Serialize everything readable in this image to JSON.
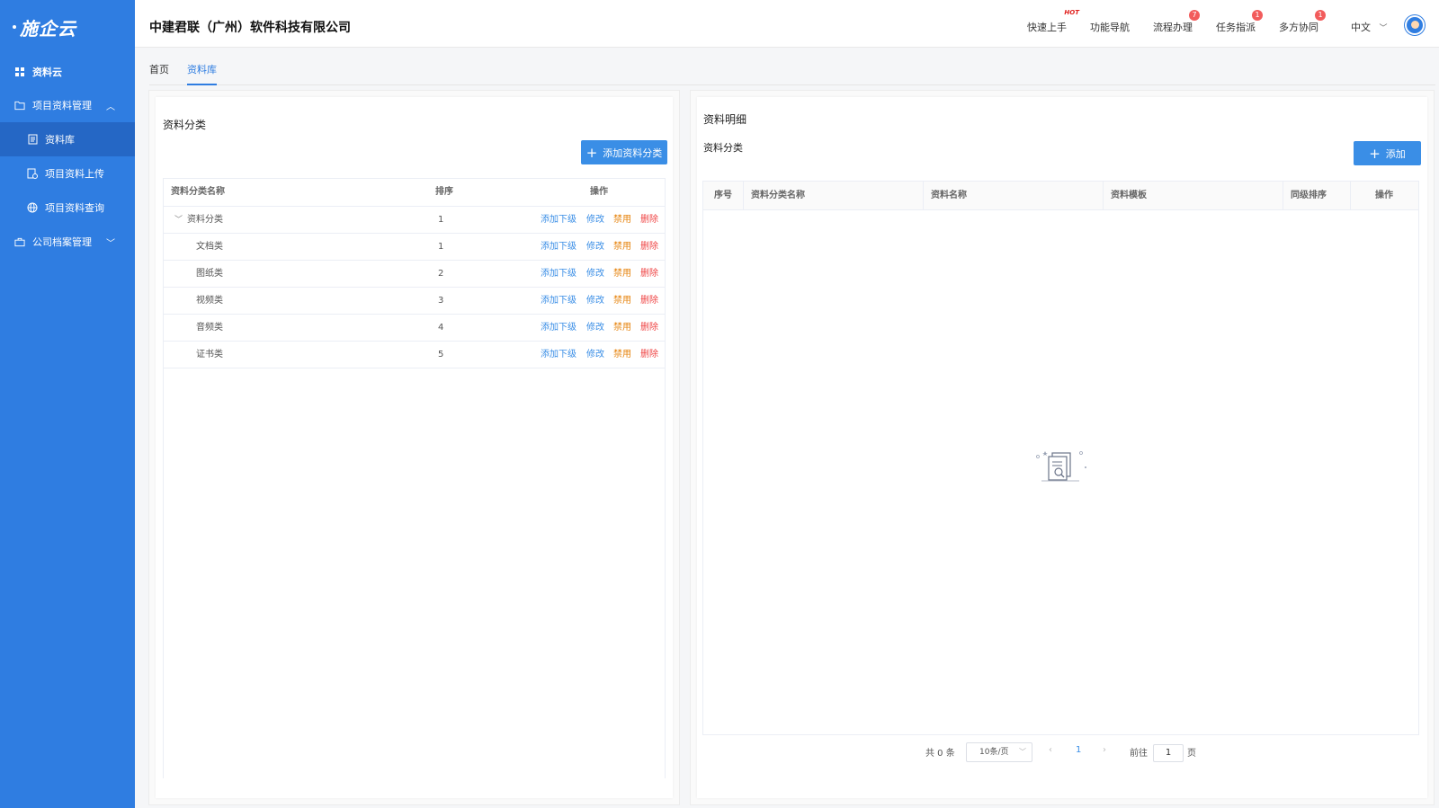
{
  "sidebar": {
    "logo": "施企云",
    "items": [
      {
        "label": "资料云"
      },
      {
        "label": "项目资料管理"
      },
      {
        "label": "资料库"
      },
      {
        "label": "项目资料上传"
      },
      {
        "label": "项目资料查询"
      },
      {
        "label": "公司档案管理"
      }
    ]
  },
  "header": {
    "company": "中建君联（广州）软件科技有限公司",
    "nav": [
      {
        "label": "快速上手",
        "badge": "HOT"
      },
      {
        "label": "功能导航",
        "badge": ""
      },
      {
        "label": "流程办理",
        "badge": "7"
      },
      {
        "label": "任务指派",
        "badge": "1"
      },
      {
        "label": "多方协同",
        "badge": "1"
      }
    ],
    "language": "中文"
  },
  "tabs": [
    {
      "label": "首页"
    },
    {
      "label": "资料库"
    }
  ],
  "left_panel": {
    "title": "资料分类",
    "add_button": "添加资料分类",
    "columns": [
      "资料分类名称",
      "排序",
      "操作"
    ],
    "actions": [
      "添加下级",
      "修改",
      "禁用",
      "删除"
    ],
    "rows": [
      {
        "name": "资料分类",
        "order": "1"
      },
      {
        "name": "文档类",
        "order": "1"
      },
      {
        "name": "图纸类",
        "order": "2"
      },
      {
        "name": "视频类",
        "order": "3"
      },
      {
        "name": "音频类",
        "order": "4"
      },
      {
        "name": "证书类",
        "order": "5"
      }
    ]
  },
  "right_panel": {
    "title": "资料明细",
    "subtitle": "资料分类",
    "add_button": "添加",
    "columns": [
      "序号",
      "资料分类名称",
      "资料名称",
      "资料模板",
      "同级排序",
      "操作"
    ]
  },
  "pagination": {
    "total": "共 0 条",
    "page_size": "10条/页",
    "current_page": "1",
    "goto_prefix": "前往",
    "goto_value": "1",
    "goto_suffix": "页"
  },
  "colors": {
    "sidebar": "#2f7de1",
    "primary": "#3a8ee6",
    "danger": "#ef4444",
    "warning": "#e6820a"
  }
}
